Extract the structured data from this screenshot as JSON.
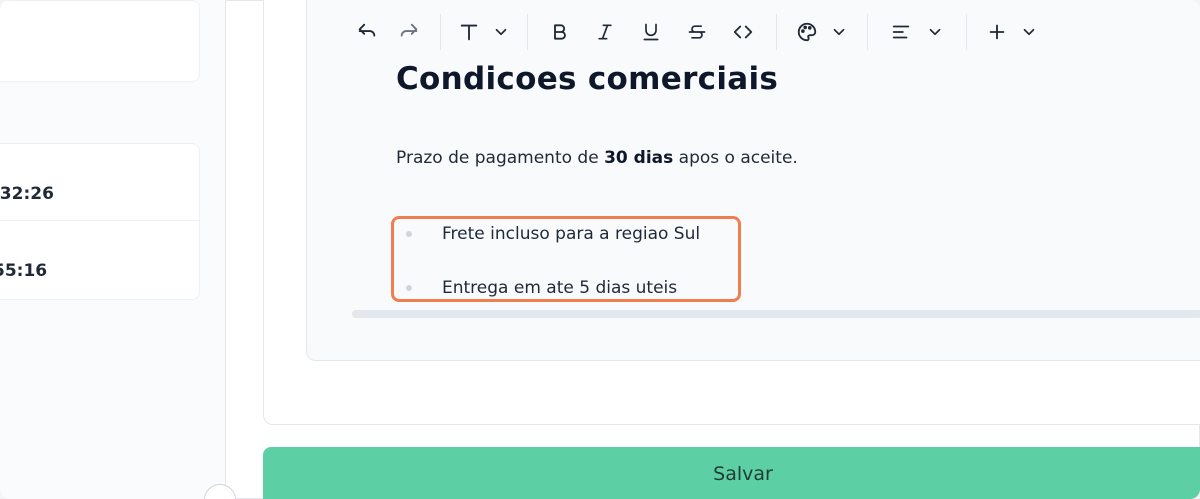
{
  "sidebar": {
    "times": [
      ":32:26",
      "55:16"
    ]
  },
  "toolbar": {
    "icons": [
      "undo-icon",
      "redo-icon",
      "text-type-icon",
      "bold-icon",
      "italic-icon",
      "underline-icon",
      "strikethrough-icon",
      "code-icon",
      "palette-icon",
      "align-icon",
      "plus-icon"
    ]
  },
  "editor": {
    "heading": "Condicoes comerciais",
    "para_before": "Prazo de pagamento de ",
    "para_bold": "30 dias",
    "para_after": " apos o aceite.",
    "list_items": [
      "Frete incluso para a regiao Sul",
      "Entrega em ate 5 dias uteis"
    ]
  },
  "actions": {
    "save_label": "Salvar"
  },
  "colors": {
    "save_bg": "#5ccfa5",
    "highlight_border": "#f07e51"
  }
}
